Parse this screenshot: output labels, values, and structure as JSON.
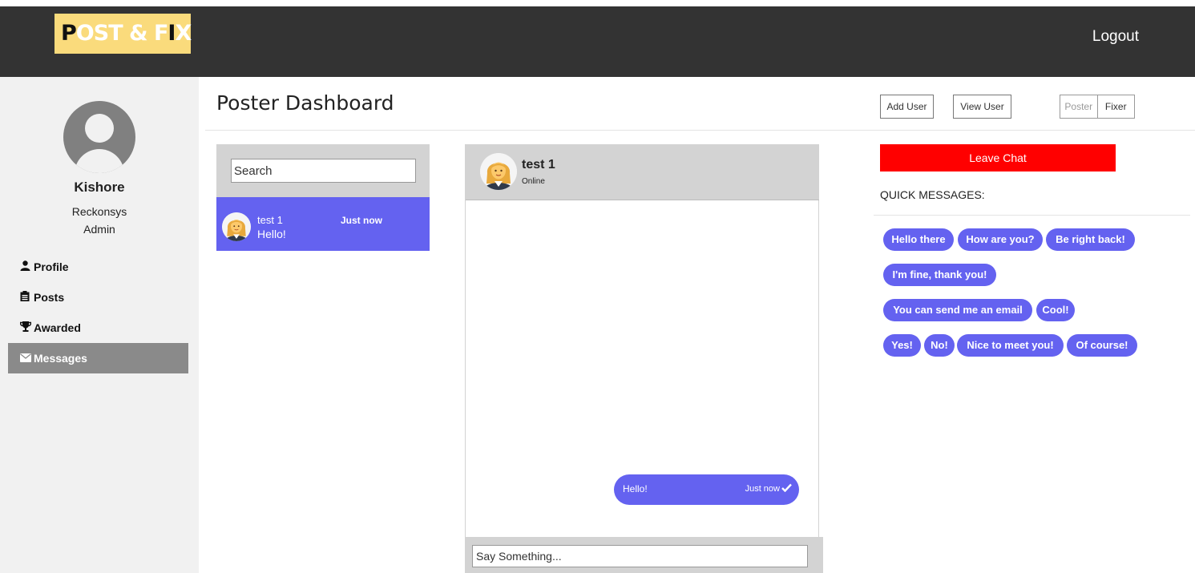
{
  "header": {
    "logo_part1": "P",
    "logo_part2": "OST & F",
    "logo_part3": "I",
    "logo_part4": "X",
    "logout_label": "Logout"
  },
  "sidebar": {
    "user_name": "Kishore",
    "organization": "Reckonsys",
    "role": "Admin",
    "items": [
      {
        "label": "Profile",
        "icon": "user-icon"
      },
      {
        "label": "Posts",
        "icon": "clipboard-icon"
      },
      {
        "label": "Awarded",
        "icon": "trophy-icon"
      },
      {
        "label": "Messages",
        "icon": "envelope-icon",
        "active": true
      }
    ]
  },
  "page": {
    "title": "Poster Dashboard",
    "add_user_label": "Add User",
    "view_user_label": "View User",
    "toggle_poster": "Poster",
    "toggle_fixer": "Fixer"
  },
  "conversations": {
    "search_placeholder": "Search",
    "items": [
      {
        "name": "test 1",
        "time": "Just now",
        "last_message": "Hello!",
        "avatar": "woman-emoji-avatar"
      }
    ]
  },
  "chat": {
    "contact_name": "test 1",
    "contact_status": "Online",
    "messages": [
      {
        "text": "Hello!",
        "time": "Just now",
        "status": "check-icon"
      }
    ],
    "input_placeholder": "Say Something..."
  },
  "quick": {
    "leave_label": "Leave Chat",
    "title": "QUICK MESSAGES:",
    "messages": [
      "Hello there",
      "How are you?",
      "Be right back!",
      "I'm fine, thank you!",
      "You can send me an email",
      "Cool!",
      "Yes!",
      "No!",
      "Nice to meet you!",
      "Of course!"
    ]
  },
  "colors": {
    "header_bg": "#333333",
    "logo_bg": "#fadb7c",
    "accent": "#6462f0",
    "danger": "#ff0000",
    "sidebar_bg": "#f1f1f1",
    "active_nav": "#8a8a8a"
  }
}
